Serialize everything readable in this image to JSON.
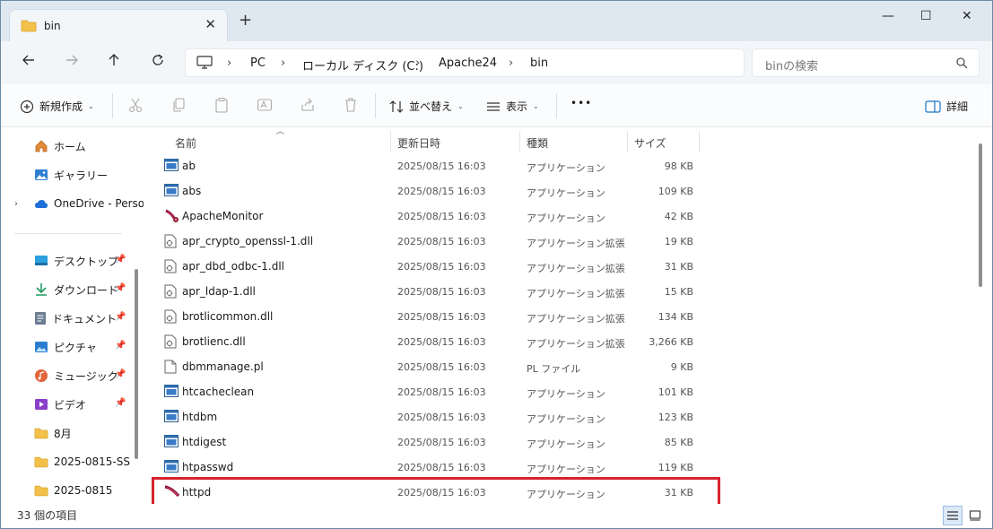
{
  "window": {
    "tab_title": "bin",
    "new_tab_symbol": "+",
    "tab_close_symbol": "✕",
    "minimize_symbol": "—",
    "maximize_symbol": "☐",
    "close_symbol": "✕"
  },
  "address": {
    "crumbs": [
      "PC",
      "ローカル ディスク (C:)",
      "Apache24",
      "bin"
    ],
    "separator": "›",
    "search_placeholder": "binの検索"
  },
  "commands": {
    "new": "新規作成",
    "sort": "並べ替え",
    "view": "表示",
    "more": "•••",
    "details": "詳細"
  },
  "sidebar": {
    "quick": [
      {
        "label": "ホーム",
        "icon": "home-icon"
      },
      {
        "label": "ギャラリー",
        "icon": "gallery-icon"
      },
      {
        "label": "OneDrive - Perso",
        "icon": "cloud-icon"
      }
    ],
    "pinned": [
      {
        "label": "デスクトップ",
        "icon": "desktop-icon"
      },
      {
        "label": "ダウンロード",
        "icon": "download-icon"
      },
      {
        "label": "ドキュメント",
        "icon": "document-icon"
      },
      {
        "label": "ピクチャ",
        "icon": "picture-icon"
      },
      {
        "label": "ミュージック",
        "icon": "music-icon"
      },
      {
        "label": "ビデオ",
        "icon": "video-icon"
      }
    ],
    "folders": [
      {
        "label": "8月",
        "icon": "folder-icon"
      },
      {
        "label": "2025-0815-SS",
        "icon": "folder-icon"
      },
      {
        "label": "2025-0815",
        "icon": "folder-icon"
      }
    ]
  },
  "columns": {
    "name": "名前",
    "date": "更新日時",
    "type": "種類",
    "size": "サイズ"
  },
  "files": [
    {
      "name": "ab",
      "date": "2025/08/15 16:03",
      "type": "アプリケーション",
      "size": "98 KB",
      "icon": "exe"
    },
    {
      "name": "abs",
      "date": "2025/08/15 16:03",
      "type": "アプリケーション",
      "size": "109 KB",
      "icon": "exe"
    },
    {
      "name": "ApacheMonitor",
      "date": "2025/08/15 16:03",
      "type": "アプリケーション",
      "size": "42 KB",
      "icon": "monitor"
    },
    {
      "name": "apr_crypto_openssl-1.dll",
      "date": "2025/08/15 16:03",
      "type": "アプリケーション拡張",
      "size": "19 KB",
      "icon": "dll"
    },
    {
      "name": "apr_dbd_odbc-1.dll",
      "date": "2025/08/15 16:03",
      "type": "アプリケーション拡張",
      "size": "31 KB",
      "icon": "dll"
    },
    {
      "name": "apr_ldap-1.dll",
      "date": "2025/08/15 16:03",
      "type": "アプリケーション拡張",
      "size": "15 KB",
      "icon": "dll"
    },
    {
      "name": "brotlicommon.dll",
      "date": "2025/08/15 16:03",
      "type": "アプリケーション拡張",
      "size": "134 KB",
      "icon": "dll"
    },
    {
      "name": "brotlienc.dll",
      "date": "2025/08/15 16:03",
      "type": "アプリケーション拡張",
      "size": "3,266 KB",
      "icon": "dll"
    },
    {
      "name": "dbmmanage.pl",
      "date": "2025/08/15 16:03",
      "type": "PL ファイル",
      "size": "9 KB",
      "icon": "file"
    },
    {
      "name": "htcacheclean",
      "date": "2025/08/15 16:03",
      "type": "アプリケーション",
      "size": "101 KB",
      "icon": "exe"
    },
    {
      "name": "htdbm",
      "date": "2025/08/15 16:03",
      "type": "アプリケーション",
      "size": "123 KB",
      "icon": "exe"
    },
    {
      "name": "htdigest",
      "date": "2025/08/15 16:03",
      "type": "アプリケーション",
      "size": "85 KB",
      "icon": "exe"
    },
    {
      "name": "htpasswd",
      "date": "2025/08/15 16:03",
      "type": "アプリケーション",
      "size": "119 KB",
      "icon": "exe"
    },
    {
      "name": "httpd",
      "date": "2025/08/15 16:03",
      "type": "アプリケーション",
      "size": "31 KB",
      "icon": "feather"
    }
  ],
  "status": {
    "item_count": "33 個の項目"
  },
  "colors": {
    "highlight": "#d6232c",
    "folder": "#f3c14a",
    "accent": "#1a73c8"
  }
}
